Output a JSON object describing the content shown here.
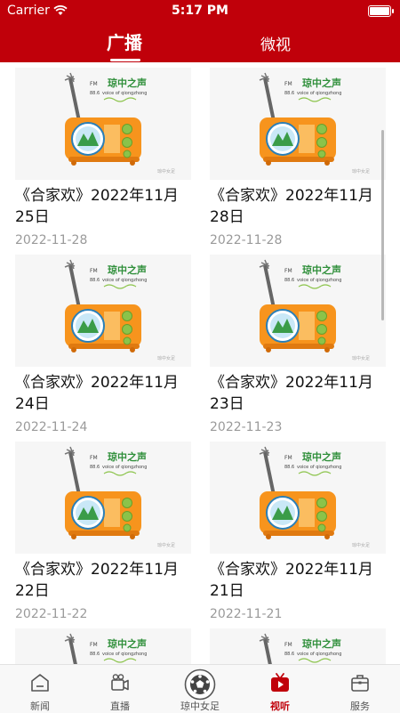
{
  "status_bar": {
    "carrier": "Carrier",
    "time": "5:17 PM"
  },
  "tabs": [
    {
      "label": "广播",
      "active": true
    },
    {
      "label": "微视",
      "active": false
    }
  ],
  "thumbnail": {
    "fm_label": "FM",
    "brand_text": "琼中之声",
    "fm_number": "88.6",
    "slogan": "voice of qiongzhong",
    "watermark": "琼中女足"
  },
  "items": [
    {
      "title": "《合家欢》2022年11月25日",
      "date": "2022-11-28"
    },
    {
      "title": "《合家欢》2022年11月28日",
      "date": "2022-11-28"
    },
    {
      "title": "《合家欢》2022年11月24日",
      "date": "2022-11-24"
    },
    {
      "title": "《合家欢》2022年11月23日",
      "date": "2022-11-23"
    },
    {
      "title": "《合家欢》2022年11月22日",
      "date": "2022-11-22"
    },
    {
      "title": "《合家欢》2022年11月21日",
      "date": "2022-11-21"
    }
  ],
  "bottom_nav": [
    {
      "label": "新闻",
      "icon": "home-icon"
    },
    {
      "label": "直播",
      "icon": "video-camera-icon"
    },
    {
      "label": "琼中女足",
      "icon": "soccer-ball-icon"
    },
    {
      "label": "视听",
      "icon": "tv-icon",
      "active": true
    },
    {
      "label": "服务",
      "icon": "briefcase-icon"
    }
  ],
  "colors": {
    "brand_red": "#c0000a",
    "radio_orange": "#f7941d",
    "date_gray": "#9a9a9a"
  }
}
